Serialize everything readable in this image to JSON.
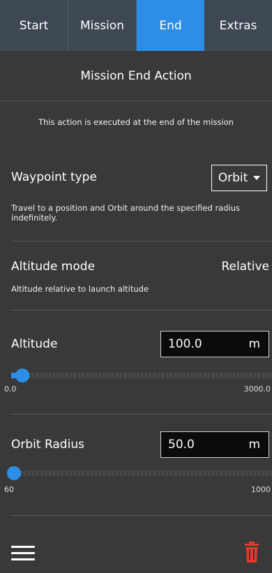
{
  "tabs": [
    {
      "label": "Start",
      "active": false
    },
    {
      "label": "Mission",
      "active": false
    },
    {
      "label": "End",
      "active": true
    },
    {
      "label": "Extras",
      "active": false
    }
  ],
  "section": {
    "title": "Mission End Action",
    "subtitle": "This action is executed at the end of the mission"
  },
  "waypoint": {
    "label": "Waypoint type",
    "selected": "Orbit",
    "description": "Travel to a position and Orbit around the specified radius indefinitely."
  },
  "altitude_mode": {
    "label": "Altitude mode",
    "value": "Relative",
    "description": "Altitude relative to launch altitude"
  },
  "altitude": {
    "label": "Altitude",
    "value": "100.0",
    "unit": "m",
    "min": "0.0",
    "max": "3000.0",
    "slider_fraction": 0.033
  },
  "orbit_radius": {
    "label": "Orbit Radius",
    "value": "50.0",
    "unit": "m",
    "min": "60",
    "max": "1000",
    "slider_fraction": 0.0
  },
  "icons": {
    "menu": "menu-icon",
    "delete": "trash-icon"
  },
  "colors": {
    "accent": "#2c8ee6",
    "tab_bar": "#3d4853",
    "background": "#393939",
    "delete": "#e8382c"
  }
}
